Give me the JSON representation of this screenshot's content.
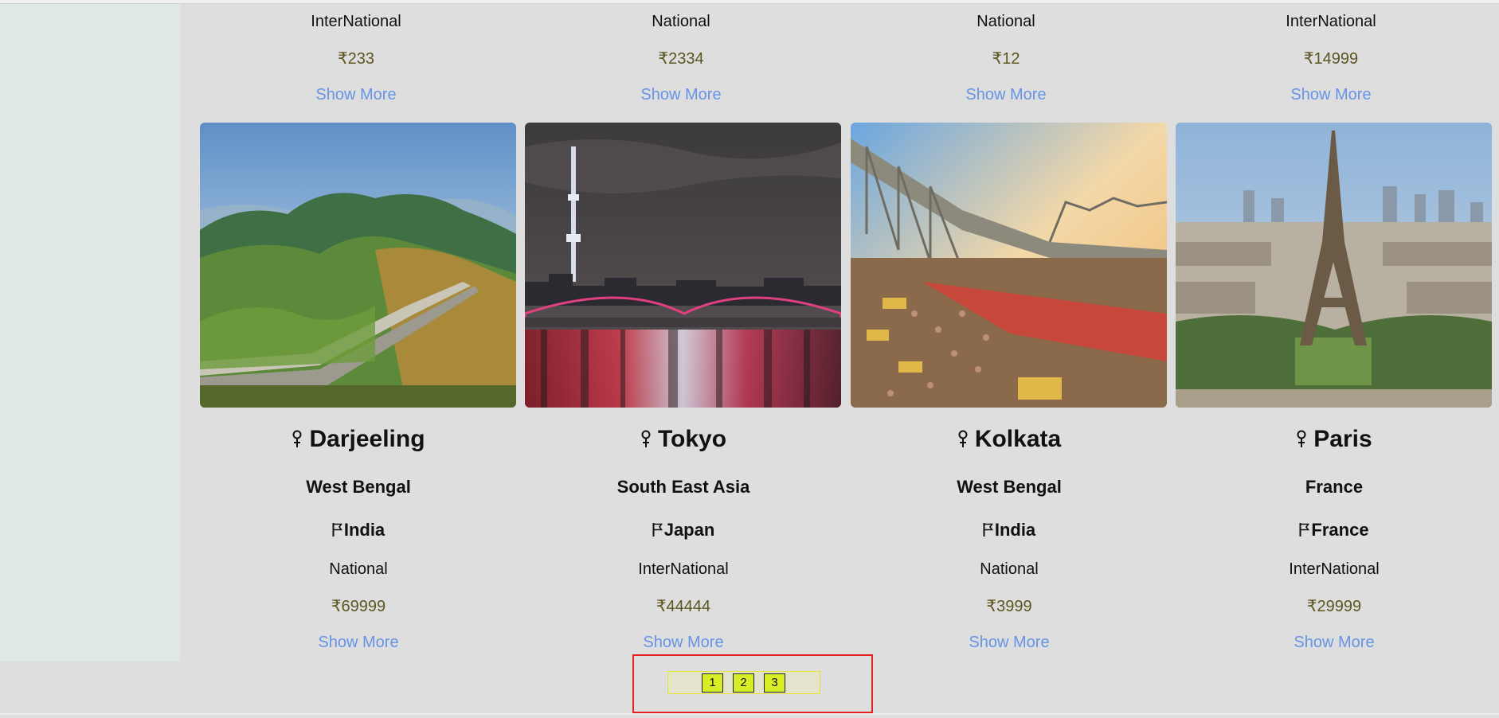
{
  "top_row": [
    {
      "category": "InterNational",
      "price": "₹233",
      "show_more": "Show More"
    },
    {
      "category": "National",
      "price": "₹2334",
      "show_more": "Show More"
    },
    {
      "category": "National",
      "price": "₹12",
      "show_more": "Show More"
    },
    {
      "category": "InterNational",
      "price": "₹14999",
      "show_more": "Show More"
    }
  ],
  "cards": [
    {
      "title": "Darjeeling",
      "region": "West Bengal",
      "country": "India",
      "category": "National",
      "price": "₹69999",
      "show_more": "Show More",
      "image": "mountain-landscape-photo"
    },
    {
      "title": "Tokyo",
      "region": "South East Asia",
      "country": "Japan",
      "category": "InterNational",
      "price": "₹44444",
      "show_more": "Show More",
      "image": "tokyo-night-skyline-photo"
    },
    {
      "title": "Kolkata",
      "region": "West Bengal",
      "country": "India",
      "category": "National",
      "price": "₹3999",
      "show_more": "Show More",
      "image": "howrah-bridge-street-photo"
    },
    {
      "title": "Paris",
      "region": "France",
      "country": "France",
      "category": "InterNational",
      "price": "₹29999",
      "show_more": "Show More",
      "image": "eiffel-tower-city-photo"
    }
  ],
  "pagination": {
    "pages": [
      "1",
      "2",
      "3"
    ]
  },
  "icons": {
    "title_icon": "location-pin-icon",
    "country_icon": "flag-icon"
  },
  "colors": {
    "link": "#6694e6",
    "price": "#5d5520",
    "page_button": "#d7ee27",
    "highlight_box": "#e52222"
  }
}
